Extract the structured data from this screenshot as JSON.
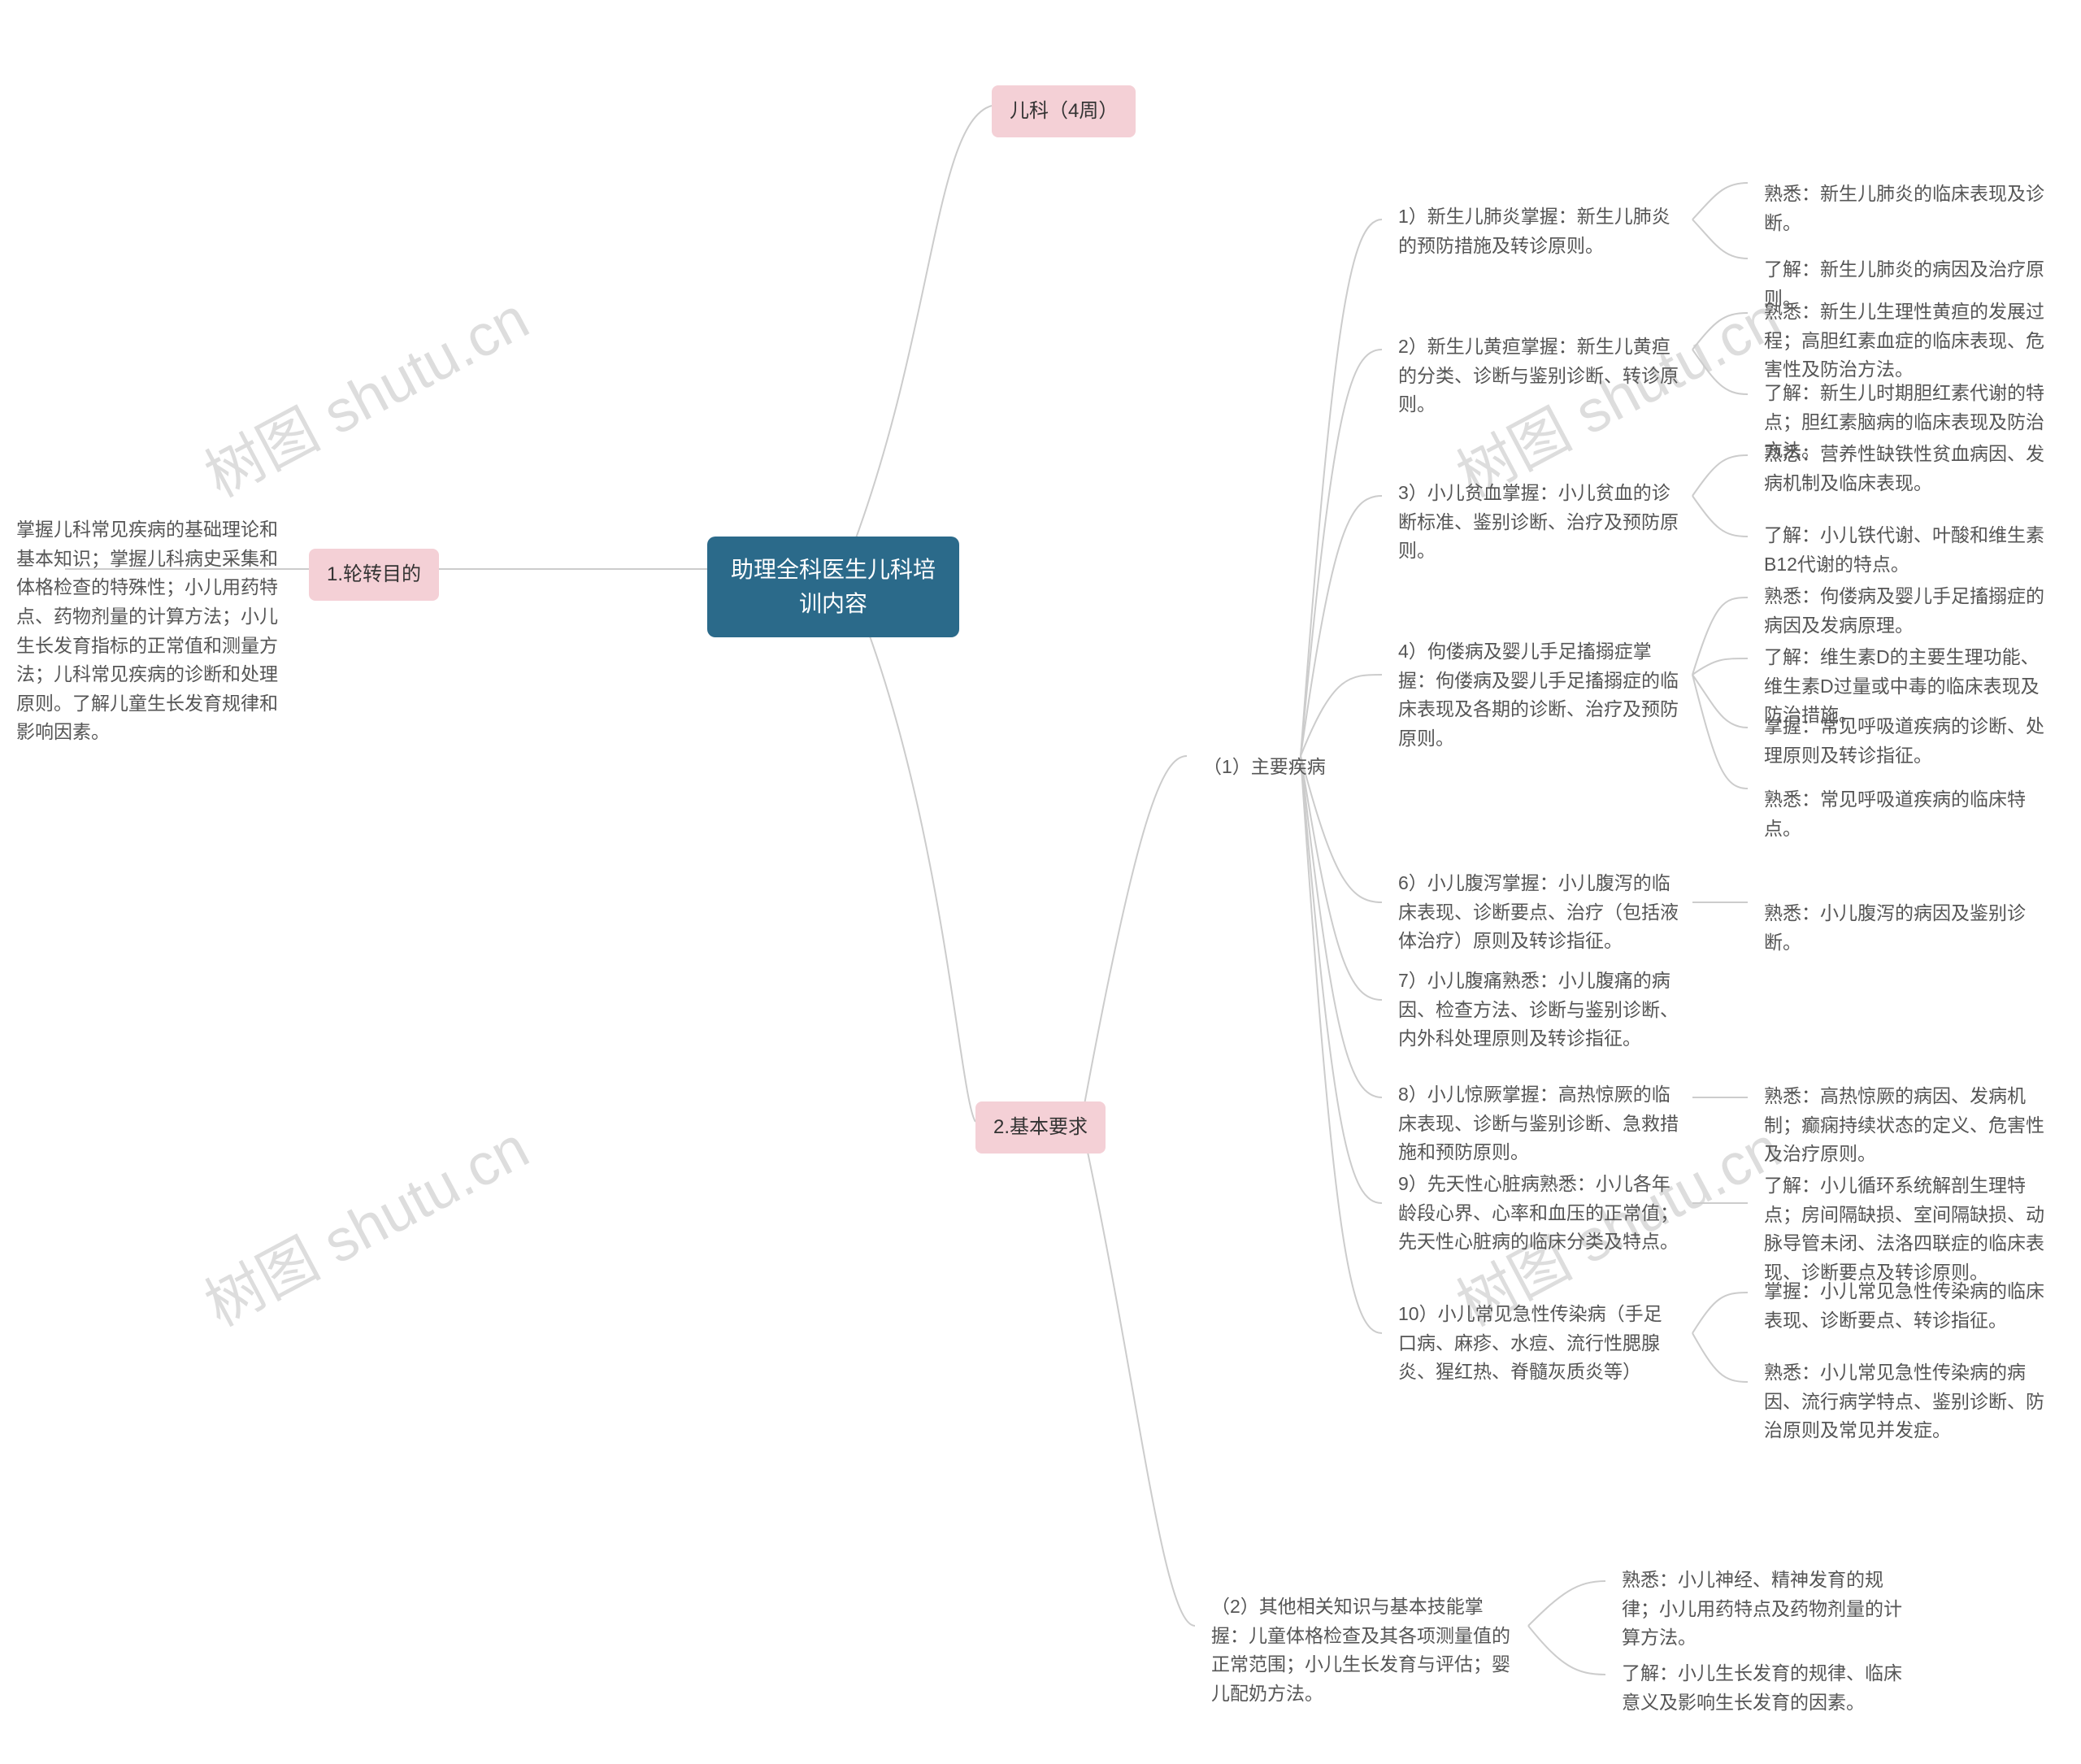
{
  "watermark": "树图 shutu.cn",
  "root": "助理全科医生儿科培训内容",
  "branch_top": "儿科（4周）",
  "branch1": {
    "label": "1.轮转目的",
    "desc": "掌握儿科常见疾病的基础理论和基本知识；掌握儿科病史采集和体格检查的特殊性；小儿用药特点、药物剂量的计算方法；小儿生长发育指标的正常值和测量方法；儿科常见疾病的诊断和处理原则。了解儿童生长发育规律和影响因素。"
  },
  "branch2": {
    "label": "2.基本要求",
    "sub1": {
      "label": "（1）主要疾病",
      "items": [
        {
          "title": "1）新生儿肺炎掌握：新生儿肺炎的预防措施及转诊原则。",
          "children": [
            "熟悉：新生儿肺炎的临床表现及诊断。",
            "了解：新生儿肺炎的病因及治疗原则。"
          ]
        },
        {
          "title": "2）新生儿黄疸掌握：新生儿黄疸的分类、诊断与鉴别诊断、转诊原则。",
          "children": [
            "熟悉：新生儿生理性黄疸的发展过程；高胆红素血症的临床表现、危害性及防治方法。",
            "了解：新生儿时期胆红素代谢的特点；胆红素脑病的临床表现及防治方法。"
          ]
        },
        {
          "title": "3）小儿贫血掌握：小儿贫血的诊断标准、鉴别诊断、治疗及预防原则。",
          "children": [
            "熟悉：营养性缺铁性贫血病因、发病机制及临床表现。",
            "了解：小儿铁代谢、叶酸和维生素B12代谢的特点。"
          ]
        },
        {
          "title": "4）佝偻病及婴儿手足搐搦症掌握：佝偻病及婴儿手足搐搦症的临床表现及各期的诊断、治疗及预防原则。",
          "children": [
            "熟悉：佝偻病及婴儿手足搐搦症的病因及发病原理。",
            "了解：维生素D的主要生理功能、维生素D过量或中毒的临床表现及防治措施。",
            "掌握：常见呼吸道疾病的诊断、处理原则及转诊指征。",
            "熟悉：常见呼吸道疾病的临床特点。"
          ]
        },
        {
          "title": "6）小儿腹泻掌握：小儿腹泻的临床表现、诊断要点、治疗（包括液体治疗）原则及转诊指征。",
          "children": [
            "熟悉：小儿腹泻的病因及鉴别诊断。"
          ]
        },
        {
          "title": "7）小儿腹痛熟悉：小儿腹痛的病因、检查方法、诊断与鉴别诊断、内外科处理原则及转诊指征。",
          "children": []
        },
        {
          "title": "8）小儿惊厥掌握：高热惊厥的临床表现、诊断与鉴别诊断、急救措施和预防原则。",
          "children": [
            "熟悉：高热惊厥的病因、发病机制；癫痫持续状态的定义、危害性及治疗原则。"
          ]
        },
        {
          "title": "9）先天性心脏病熟悉：小儿各年龄段心界、心率和血压的正常值；先天性心脏病的临床分类及特点。",
          "children": [
            "了解：小儿循环系统解剖生理特点；房间隔缺损、室间隔缺损、动脉导管未闭、法洛四联症的临床表现、诊断要点及转诊原则。"
          ]
        },
        {
          "title": "10）小儿常见急性传染病（手足口病、麻疹、水痘、流行性腮腺炎、猩红热、脊髓灰质炎等）",
          "children": [
            "掌握：小儿常见急性传染病的临床表现、诊断要点、转诊指征。",
            "熟悉：小儿常见急性传染病的病因、流行病学特点、鉴别诊断、防治原则及常见并发症。"
          ]
        }
      ]
    },
    "sub2": {
      "title": "（2）其他相关知识与基本技能掌握：儿童体格检查及其各项测量值的正常范围；小儿生长发育与评估；婴儿配奶方法。",
      "children": [
        "熟悉：小儿神经、精神发育的规律；小儿用药特点及药物剂量的计算方法。",
        "了解：小儿生长发育的规律、临床意义及影响生长发育的因素。"
      ]
    }
  }
}
